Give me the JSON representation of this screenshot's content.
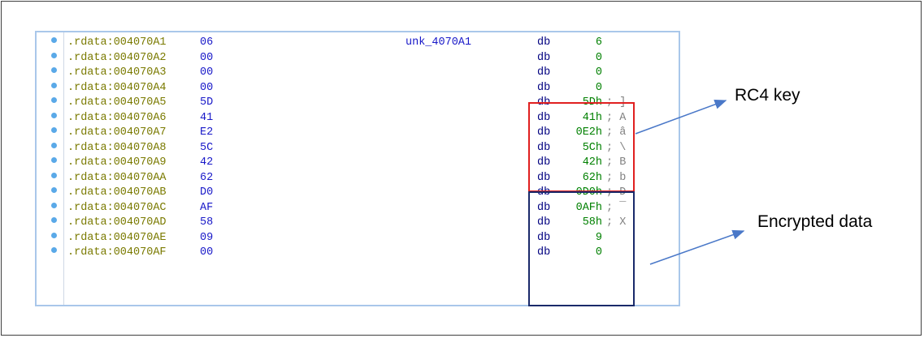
{
  "rows": [
    {
      "seg": ".rdata:004070A1",
      "byte": "06",
      "label": "unk_4070A1",
      "op": "db",
      "val": "6",
      "cmt": ""
    },
    {
      "seg": ".rdata:004070A2",
      "byte": "00",
      "label": "",
      "op": "db",
      "val": "0",
      "cmt": ""
    },
    {
      "seg": ".rdata:004070A3",
      "byte": "00",
      "label": "",
      "op": "db",
      "val": "0",
      "cmt": ""
    },
    {
      "seg": ".rdata:004070A4",
      "byte": "00",
      "label": "",
      "op": "db",
      "val": "0",
      "cmt": ""
    },
    {
      "seg": ".rdata:004070A5",
      "byte": "5D",
      "label": "",
      "op": "db",
      "val": "5Dh",
      "cmt": "; ]"
    },
    {
      "seg": ".rdata:004070A6",
      "byte": "41",
      "label": "",
      "op": "db",
      "val": "41h",
      "cmt": "; A"
    },
    {
      "seg": ".rdata:004070A7",
      "byte": "E2",
      "label": "",
      "op": "db",
      "val": "0E2h",
      "cmt": "; â"
    },
    {
      "seg": ".rdata:004070A8",
      "byte": "5C",
      "label": "",
      "op": "db",
      "val": "5Ch",
      "cmt": "; \\"
    },
    {
      "seg": ".rdata:004070A9",
      "byte": "42",
      "label": "",
      "op": "db",
      "val": "42h",
      "cmt": "; B"
    },
    {
      "seg": ".rdata:004070AA",
      "byte": "62",
      "label": "",
      "op": "db",
      "val": "62h",
      "cmt": "; b"
    },
    {
      "seg": ".rdata:004070AB",
      "byte": "D0",
      "label": "",
      "op": "db",
      "val": "0D0h",
      "cmt": "; Ð"
    },
    {
      "seg": ".rdata:004070AC",
      "byte": "AF",
      "label": "",
      "op": "db",
      "val": "0AFh",
      "cmt": "; ¯"
    },
    {
      "seg": ".rdata:004070AD",
      "byte": "58",
      "label": "",
      "op": "db",
      "val": "58h",
      "cmt": "; X"
    },
    {
      "seg": ".rdata:004070AE",
      "byte": "09",
      "label": "",
      "op": "db",
      "val": "9",
      "cmt": ""
    },
    {
      "seg": ".rdata:004070AF",
      "byte": "00",
      "label": "",
      "op": "db",
      "val": "0",
      "cmt": ""
    }
  ],
  "annotations": {
    "rc4_key": "RC4 key",
    "encrypted_data": "Encrypted data"
  },
  "colors": {
    "key_box": "#e02020",
    "data_box": "#1a2a6a",
    "arrow": "#4a78c8"
  }
}
